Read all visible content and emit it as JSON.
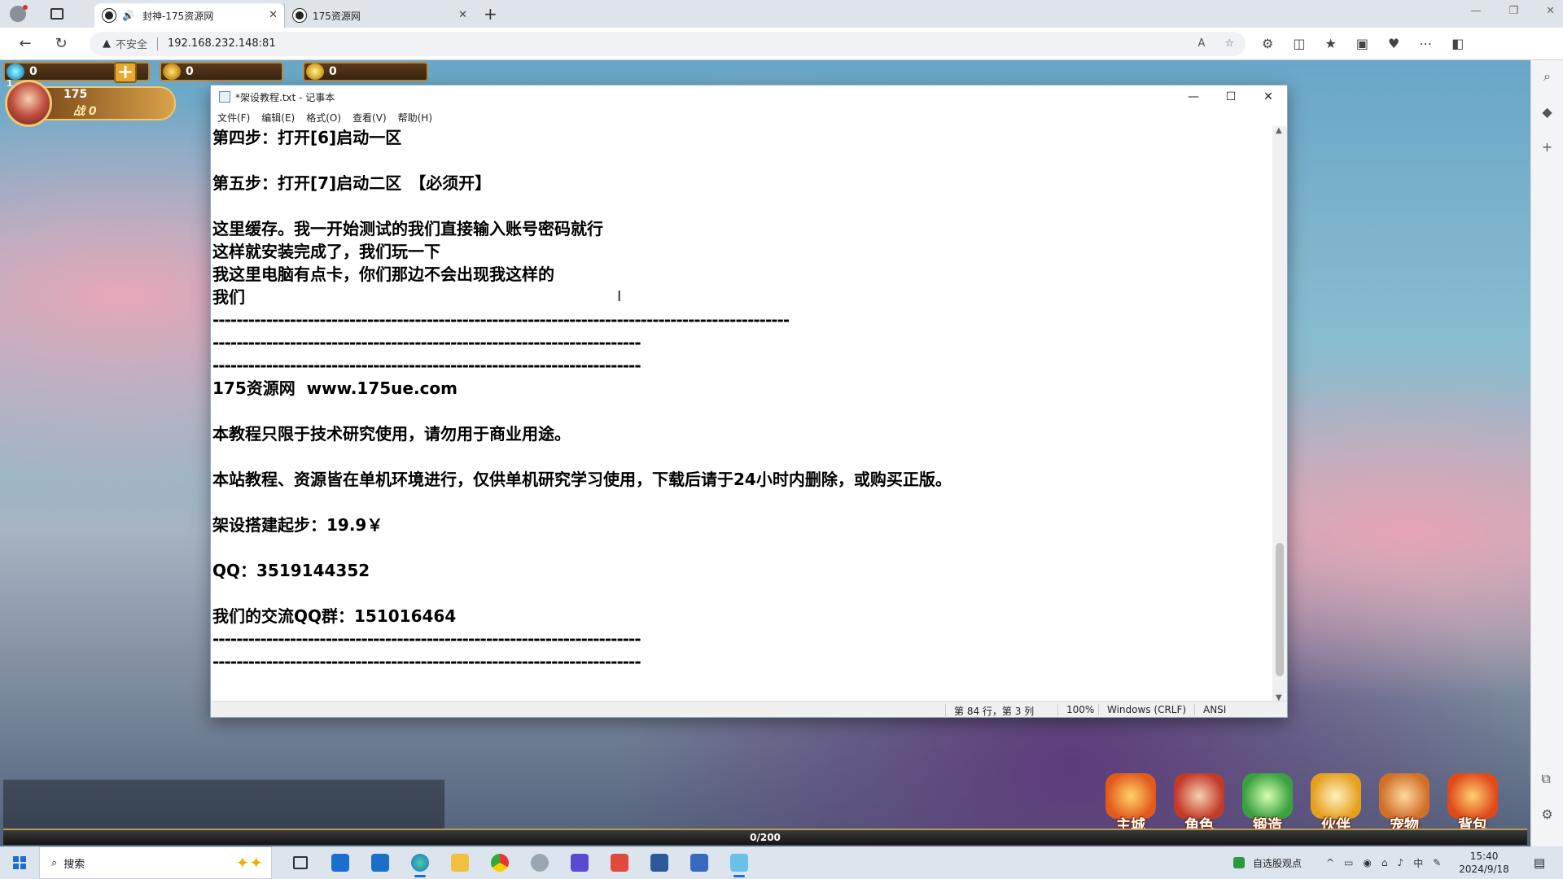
{
  "browser": {
    "tabs": [
      {
        "label": "封神-175资源网",
        "active": true
      },
      {
        "label": "175资源网",
        "active": false
      }
    ],
    "address": {
      "security_label": "不安全",
      "url": "192.168.232.148:81"
    }
  },
  "game": {
    "gems": "0",
    "gold": "0",
    "coupons": "0",
    "player_level": "1",
    "player_number": "175",
    "power": "战 0",
    "chat_count": "0/200",
    "menu": [
      {
        "label": "主城",
        "icon": "city-icon",
        "color": "#e25a1c"
      },
      {
        "label": "角色",
        "icon": "character-icon",
        "color": "#c23a2a"
      },
      {
        "label": "锻造",
        "icon": "forge-icon",
        "color": "#3aa040"
      },
      {
        "label": "伙伴",
        "icon": "partner-icon",
        "color": "#e6a020"
      },
      {
        "label": "宠物",
        "icon": "pet-icon",
        "color": "#d0702a"
      },
      {
        "label": "背包",
        "icon": "bag-icon",
        "color": "#e04a1a"
      }
    ]
  },
  "notepad": {
    "title": "*架设教程.txt - 记事本",
    "menu": [
      "文件(F)",
      "编辑(E)",
      "格式(O)",
      "查看(V)",
      "帮助(H)"
    ],
    "lines": [
      "第四步：打开[6]启动一区",
      "",
      "第五步：打开[7]启动二区　【必须开】",
      "",
      "这里缓存。我一开始测试的我们直接输入账号密码就行",
      "这样就安装完成了，我们玩一下",
      "我这里电脑有点卡，你们那边不会出现我这样的",
      "我们",
      "-------------------------------------------------------------------------------------------------",
      "------------------------------------------------------------------------",
      "------------------------------------------------------------------------",
      "175资源网  www.175ue.com",
      "",
      "本教程只限于技术研究使用，请勿用于商业用途。",
      "",
      "本站教程、资源皆在单机环境进行，仅供单机研究学习使用，下载后请于24小时内删除，或购买正版。",
      "",
      "架设搭建起步：19.9￥",
      "",
      "QQ：3519144352",
      "",
      "我们的交流QQ群：151016464",
      "------------------------------------------------------------------------",
      "------------------------------------------------------------------------"
    ],
    "status": {
      "position": "第 84 行，第 3 列",
      "zoom": "100%",
      "line_ending": "Windows (CRLF)",
      "encoding": "ANSI"
    }
  },
  "taskbar": {
    "search_label": "搜索",
    "stock_label": "自选股观点",
    "ime": "中",
    "time": "15:40",
    "date": "2024/9/18"
  }
}
